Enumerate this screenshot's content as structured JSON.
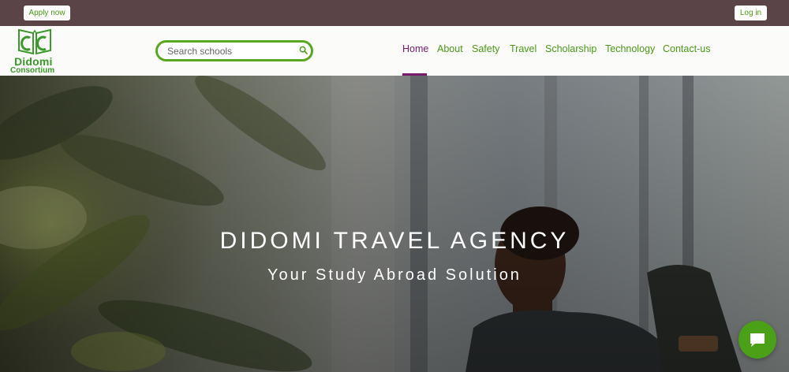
{
  "topbar": {
    "apply_label": "Apply now",
    "login_label": "Log in"
  },
  "logo": {
    "line1": "Didomi",
    "line2": "Consortium",
    "icon": "open-book-dc-logo"
  },
  "search": {
    "placeholder": "Search schools",
    "value": "",
    "icon": "search-icon"
  },
  "nav": {
    "items": [
      {
        "label": "Home",
        "active": true
      },
      {
        "label": "About",
        "active": false
      },
      {
        "label": "Safety",
        "active": false
      },
      {
        "label": "Travel",
        "active": false
      },
      {
        "label": "Scholarship",
        "active": false
      },
      {
        "label": "Technology",
        "active": false
      },
      {
        "label": "Contact-us",
        "active": false
      }
    ]
  },
  "hero": {
    "title": "DIDOMI TRAVEL AGENCY",
    "subtitle": "Your Study Abroad Solution"
  },
  "chat": {
    "icon": "chat-bubble-icon"
  },
  "colors": {
    "topbar_bg": "#5b4447",
    "brand_green": "#4a9a17",
    "active_nav": "#7a1a6e",
    "chat_bg": "#4aa017"
  }
}
